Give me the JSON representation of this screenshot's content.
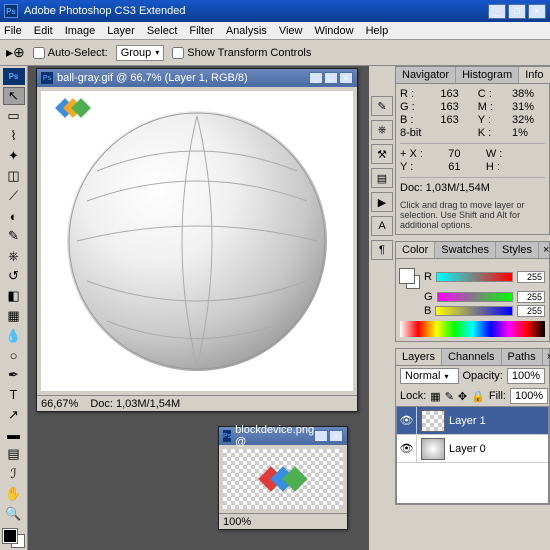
{
  "app": {
    "title": "Adobe Photoshop CS3 Extended"
  },
  "menu": [
    "File",
    "Edit",
    "Image",
    "Layer",
    "Select",
    "Filter",
    "Analysis",
    "View",
    "Window",
    "Help"
  ],
  "options": {
    "auto_select": "Auto-Select:",
    "group": "Group",
    "transform": "Show Transform Controls"
  },
  "doc1": {
    "title": "ball-gray.gif @ 66,7% (Layer 1, RGB/8)",
    "zoom": "66,67%",
    "status": "Doc: 1,03M/1,54M"
  },
  "doc2": {
    "title": "blockdevice.png @",
    "zoom": "100%"
  },
  "info": {
    "tabs": {
      "nav": "Navigator",
      "hist": "Histogram",
      "info": "Info"
    },
    "r": "R :",
    "r_v": "163",
    "c": "C :",
    "c_v": "38%",
    "g": "G :",
    "g_v": "163",
    "m": "M :",
    "m_v": "31%",
    "b": "B :",
    "b_v": "163",
    "y": "Y :",
    "y_v": "32%",
    "eight": "8-bit",
    "k": "K :",
    "k_v": "1%",
    "x": "X :",
    "x_v": "70",
    "w": "W :",
    "yy": "Y :",
    "yy_v": "61",
    "h": "H :",
    "doc": "Doc: 1,03M/1,54M",
    "hint": "Click and drag to move layer or selection. Use Shift and Alt for additional options."
  },
  "color": {
    "tabs": {
      "color": "Color",
      "swatches": "Swatches",
      "styles": "Styles"
    },
    "r": "R",
    "g": "G",
    "b": "B",
    "val": "255"
  },
  "layers": {
    "tabs": {
      "layers": "Layers",
      "channels": "Channels",
      "paths": "Paths"
    },
    "blend": "Normal",
    "opacity_l": "Opacity:",
    "opacity_v": "100%",
    "lock": "Lock:",
    "fill_l": "Fill:",
    "fill_v": "100%",
    "l1": "Layer 1",
    "l0": "Layer 0"
  }
}
